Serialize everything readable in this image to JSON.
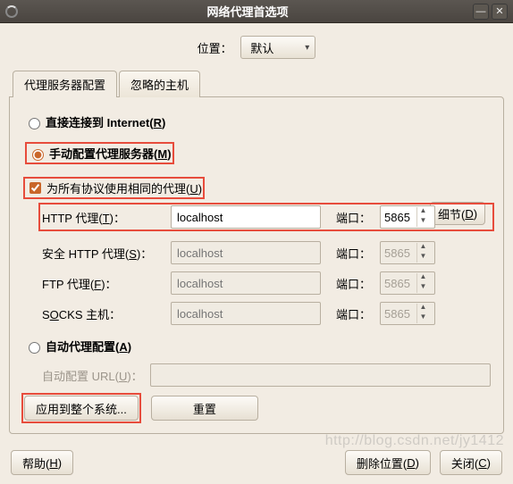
{
  "window": {
    "title": "网络代理首选项"
  },
  "location": {
    "label": "位置：",
    "value": "默认"
  },
  "tabs": {
    "t0": "代理服务器配置",
    "t1": "忽略的主机"
  },
  "opts": {
    "direct": "直接连接到 Internet(",
    "direct_u": "R",
    "direct_end": ")",
    "manual": "手动配置代理服务器(",
    "manual_u": "M",
    "manual_end": ")",
    "sameall": "为所有协议使用相同的代理(",
    "sameall_u": "U",
    "sameall_end": ")",
    "auto": "自动代理配置(",
    "auto_u": "A",
    "auto_end": ")"
  },
  "proxy": {
    "http_label_pre": "HTTP 代理(",
    "http_u": "T",
    "http_label_post": ")：",
    "http_value": "localhost",
    "https_label_pre": "安全 HTTP 代理(",
    "https_u": "S",
    "https_label_post": ")：",
    "ftp_label_pre": "FTP 代理(",
    "ftp_u": "F",
    "ftp_label_post": ")：",
    "socks_label_pre": "S",
    "socks_u": "O",
    "socks_label_post": "CKS 主机：",
    "placeholder": "localhost",
    "port_label": "端口：",
    "http_port": "5865",
    "https_port": "5865",
    "ftp_port": "5865",
    "socks_port": "5865",
    "detail_pre": "细节(",
    "detail_u": "D",
    "detail_post": ")"
  },
  "autocfg": {
    "label_pre": "自动配置 URL(",
    "label_u": "U",
    "label_post": ")：",
    "value": ""
  },
  "buttons": {
    "apply_system": "应用到整个系统...",
    "reset": "重置",
    "help_pre": "帮助(",
    "help_u": "H",
    "help_post": ")",
    "del_pre": "删除位置(",
    "del_u": "D",
    "del_post": ")",
    "close_pre": "关闭(",
    "close_u": "C",
    "close_post": ")"
  },
  "watermark": "http://blog.csdn.net/jy1412"
}
